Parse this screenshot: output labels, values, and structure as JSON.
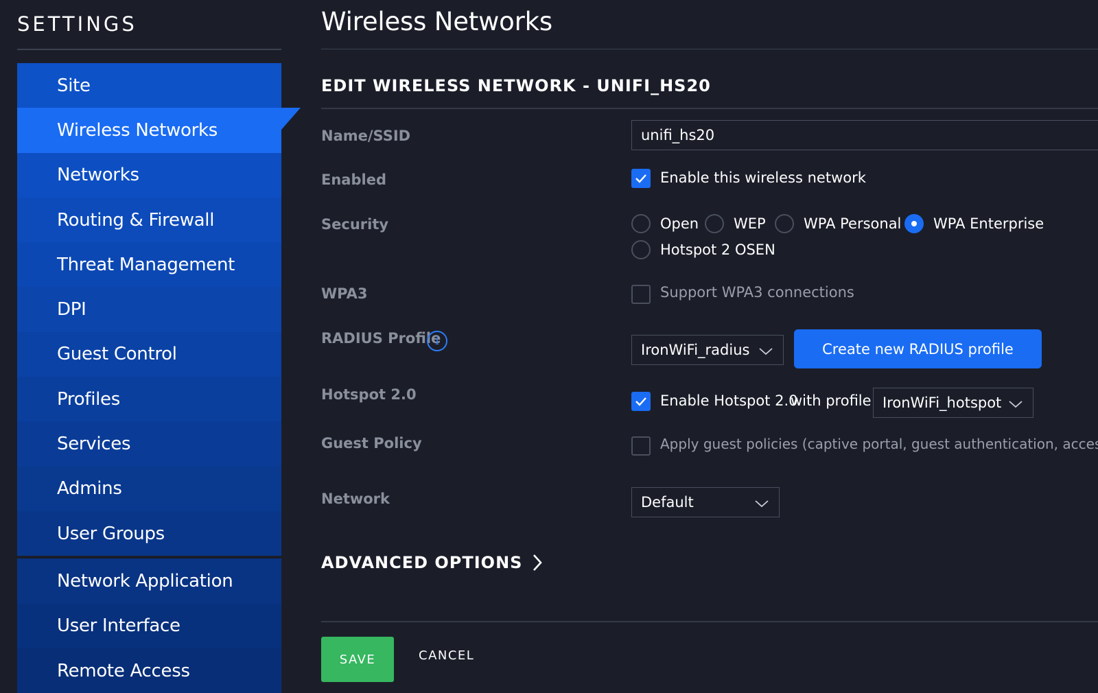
{
  "sidebar": {
    "title": "SETTINGS",
    "active_color": "#1a6cf3",
    "items": [
      {
        "label": "Site",
        "bg": "#0e52c8"
      },
      {
        "label": "Wireless Networks",
        "bg": "#1a6cf3",
        "active": true
      },
      {
        "label": "Networks",
        "bg": "#0d4fc2"
      },
      {
        "label": "Routing & Firewall",
        "bg": "#0d4bba"
      },
      {
        "label": "Threat Management",
        "bg": "#0c48b3"
      },
      {
        "label": "DPI",
        "bg": "#0c45ac"
      },
      {
        "label": "Guest Control",
        "bg": "#0b42a5"
      },
      {
        "label": "Profiles",
        "bg": "#0b3f9e"
      },
      {
        "label": "Services",
        "bg": "#0a3c97"
      },
      {
        "label": "Admins",
        "bg": "#0a3990"
      },
      {
        "label": "User Groups",
        "bg": "#093689"
      }
    ],
    "items_secondary": [
      {
        "label": "Network Application",
        "bg": "#093383"
      },
      {
        "label": "User Interface",
        "bg": "#08317d"
      },
      {
        "label": "Remote Access",
        "bg": "#082e77"
      }
    ]
  },
  "main": {
    "page_title": "Wireless Networks",
    "section_title": "EDIT WIRELESS NETWORK - UNIFI_HS20",
    "fields": {
      "name": {
        "label": "Name/SSID",
        "value": "unifi_hs20"
      },
      "enabled": {
        "label": "Enabled",
        "checkbox_label": "Enable this wireless network",
        "checked": true
      },
      "security": {
        "label": "Security",
        "options": [
          "Open",
          "WEP",
          "WPA Personal",
          "WPA Enterprise",
          "Hotspot 2 OSEN"
        ],
        "selected": "WPA Enterprise"
      },
      "wpa3": {
        "label": "WPA3",
        "checkbox_label": "Support WPA3 connections",
        "checked": false
      },
      "radius": {
        "label": "RADIUS Profile",
        "info_glyph": "i",
        "selected": "IronWiFi_radius",
        "create_button": "Create new RADIUS profile"
      },
      "hotspot": {
        "label": "Hotspot 2.0",
        "checkbox_label": "Enable Hotspot 2.0",
        "with_profile": "with profile",
        "checked": true,
        "profile": "IronWiFi_hotspot"
      },
      "guest_policy": {
        "label": "Guest Policy",
        "checkbox_label": "Apply guest policies (captive portal, guest authentication, access)",
        "checked": false
      },
      "network": {
        "label": "Network",
        "selected": "Default"
      }
    },
    "advanced_label": "ADVANCED OPTIONS",
    "save_label": "SAVE",
    "cancel_label": "CANCEL"
  },
  "colors": {
    "background": "#1b1e29",
    "accent": "#1a6cf3",
    "save": "#36b760",
    "muted_text": "#8a8f9c"
  }
}
